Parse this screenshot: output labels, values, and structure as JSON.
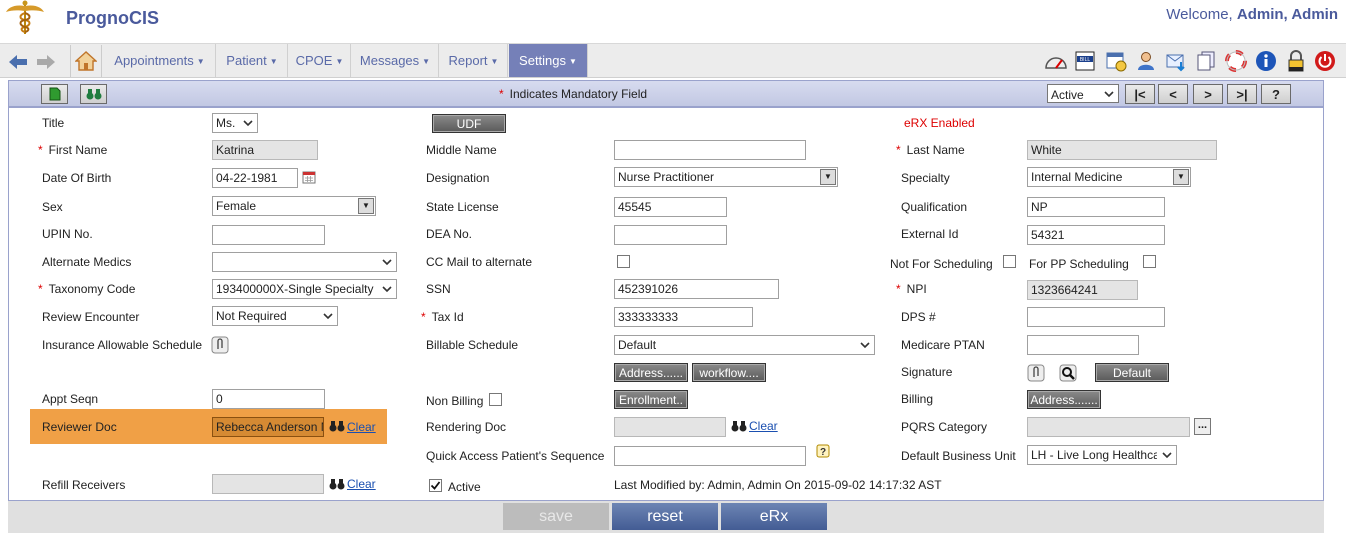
{
  "app": {
    "name": "PrognoCIS",
    "welcome_prefix": "Welcome,",
    "user": "Admin, Admin"
  },
  "nav": {
    "menus": [
      {
        "label": "Appointments"
      },
      {
        "label": "Patient"
      },
      {
        "label": "CPOE"
      },
      {
        "label": "Messages"
      },
      {
        "label": "Report"
      },
      {
        "label": "Settings"
      }
    ],
    "active": "Settings"
  },
  "toolbar": {
    "mandatory_text": "Indicates Mandatory Field",
    "status": "Active",
    "nav_first": "|<",
    "nav_prev": "<",
    "nav_next": ">",
    "nav_last": ">|",
    "help": "?"
  },
  "form": {
    "title_label": "Title",
    "title_value": "Ms.",
    "udf_button": "UDF",
    "erx_status": "eRX Enabled",
    "first_name_label": "First Name",
    "first_name_value": "Katrina",
    "middle_name_label": "Middle Name",
    "middle_name_value": "",
    "last_name_label": "Last Name",
    "last_name_value": "White",
    "dob_label": "Date Of Birth",
    "dob_value": "04-22-1981",
    "designation_label": "Designation",
    "designation_value": "Nurse Practitioner",
    "specialty_label": "Specialty",
    "specialty_value": "Internal Medicine",
    "sex_label": "Sex",
    "sex_value": "Female",
    "state_license_label": "State License",
    "state_license_value": "45545",
    "qualification_label": "Qualification",
    "qualification_value": "NP",
    "upin_label": "UPIN No.",
    "upin_value": "",
    "dea_label": "DEA No.",
    "dea_value": "",
    "external_id_label": "External Id",
    "external_id_value": "54321",
    "alternate_medics_label": "Alternate Medics",
    "alternate_medics_value": "",
    "cc_mail_label": "CC Mail to alternate",
    "not_scheduling_label": "Not For Scheduling",
    "pp_scheduling_label": "For PP Scheduling",
    "taxonomy_label": "Taxonomy Code",
    "taxonomy_value": "193400000X-Single Specialty",
    "ssn_label": "SSN",
    "ssn_value": "452391026",
    "npi_label": "NPI",
    "npi_value": "1323664241",
    "review_encounter_label": "Review Encounter",
    "review_encounter_value": "Not Required",
    "tax_id_label": "Tax Id",
    "tax_id_value": "333333333",
    "dps_label": "DPS #",
    "dps_value": "",
    "insurance_schedule_label": "Insurance Allowable Schedule",
    "billable_schedule_label": "Billable Schedule",
    "billable_schedule_value": "Default",
    "medicare_ptan_label": "Medicare PTAN",
    "medicare_ptan_value": "",
    "address_button": "Address......",
    "workflow_button": "workflow....",
    "signature_label": "Signature",
    "default_button": "Default",
    "appt_seqn_label": "Appt Seqn",
    "appt_seqn_value": "0",
    "non_billing_label": "Non Billing",
    "enrollment_button": "Enrollment..",
    "billing_label": "Billing",
    "billing_address_button": "Address.......",
    "reviewer_doc_label": "Reviewer Doc",
    "reviewer_doc_value": "Rebecca Anderson MD",
    "clear": "Clear",
    "rendering_doc_label": "Rendering Doc",
    "pqrs_label": "PQRS Category",
    "pqrs_more": "...",
    "quick_access_label": "Quick Access Patient's Sequence",
    "default_bu_label": "Default Business Unit",
    "default_bu_value": "LH - Live Long Healthcare",
    "refill_receivers_label": "Refill Receivers",
    "active_label": "Active",
    "last_modified": "Last Modified by: Admin, Admin On 2015-09-02 14:17:32 AST"
  },
  "bottom": {
    "save": "save",
    "reset": "reset",
    "erx": "eRx"
  }
}
